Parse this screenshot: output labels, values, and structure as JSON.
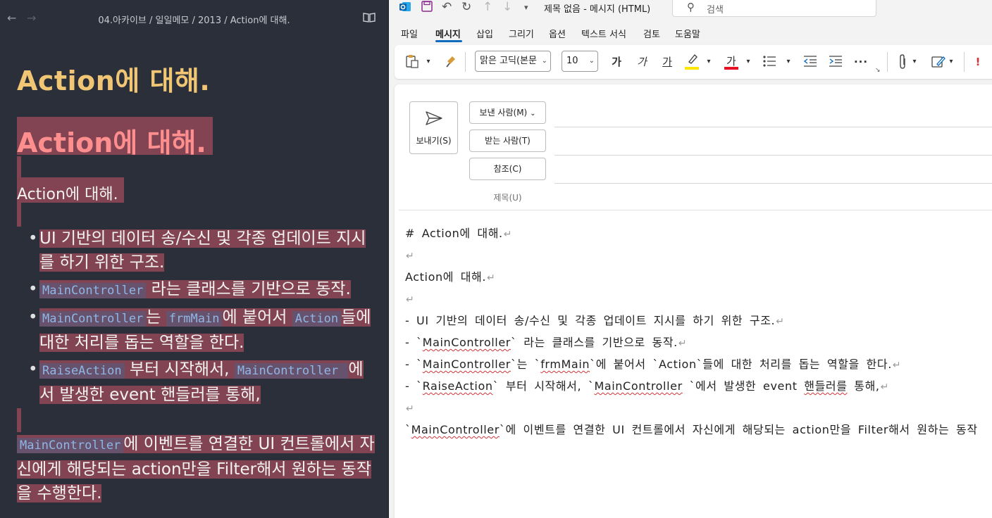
{
  "viewer": {
    "breadcrumb": "04.아카이브 / 일일메모 / 2013 / Action에 대해.",
    "title": "Action에 대해.",
    "highlight_title": "Action에 대해.",
    "paragraph": "Action에 대해.",
    "bullets": [
      {
        "pre": "",
        "code1": "",
        "text1": "UI 기반의 데이터 송/수신 및 각종 업데이트 지시를 하기 위한 구조.",
        "code2": "",
        "text2": "",
        "code3": "",
        "text3": ""
      },
      {
        "pre": "",
        "code1": "MainController",
        "text1": " 라는 클래스를 기반으로 동작.",
        "code2": "",
        "text2": "",
        "code3": "",
        "text3": ""
      },
      {
        "pre": "",
        "code1": "MainController",
        "text1": "는 ",
        "code2": "frmMain",
        "text2": "에 붙어서 ",
        "code3": "Action",
        "text3": "들에 대한 처리를 돕는 역할을 한다."
      },
      {
        "pre": "",
        "code1": "RaiseAction",
        "text1": " 부터 시작해서, ",
        "code2": "MainController ",
        "text2": "에서 발생한 event 핸들러를 통해,",
        "code3": "",
        "text3": ""
      }
    ],
    "final_code": "MainController",
    "final_text": "에 이벤트를 연결한 UI 컨트롤에서 자신에게 해당되는 action만을 Filter해서 원하는 동작을 수행한다."
  },
  "outlook": {
    "window_title": "제목 없음  -  메시지 (HTML)",
    "search_placeholder": "검색",
    "menu": [
      "파일",
      "메시지",
      "삽입",
      "그리기",
      "옵션",
      "텍스트 서식",
      "검토",
      "도움말"
    ],
    "font_name": "맑은 고딕(본문",
    "font_size": "10",
    "ribbon": {
      "bold": "가",
      "italic": "가",
      "underline": "가",
      "font_color": "가",
      "more": "···",
      "importance": "!"
    },
    "send_label": "보내기(S)",
    "from_label": "보낸 사람(M)",
    "to_label": "받는 사람(T)",
    "cc_label": "참조(C)",
    "subject_label": "제목(U)",
    "body": {
      "l1": "# Action에 대해.",
      "l3": "Action에 대해.",
      "l5": "- UI 기반의 데이터 송/수신 및 각종 업데이트 지시를 하기 위한 구조.",
      "l6a": "- `",
      "l6b": "MainController",
      "l6c": "` 라는 클래스를 기반으로 동작.",
      "l7a": "- `",
      "l7b": "MainController",
      "l7c": "`는 `",
      "l7d": "frmMain",
      "l7e": "`에 붙어서 `Action`들에 대한 처리를 돕는 역할을 한다.",
      "l8a": "- `",
      "l8b": "RaiseAction",
      "l8c": "` 부터 시작해서, `",
      "l8d": "MainController",
      "l8e": " `에서 발생한 event ",
      "l8f": "핸들러를",
      "l8g": " 통해,",
      "l10a": "`",
      "l10b": "MainController",
      "l10c": "`에 이벤트를 연결한 UI 컨트롤에서 자신에게 해당되는 action만을 Filter해서 원하는 동작"
    }
  }
}
